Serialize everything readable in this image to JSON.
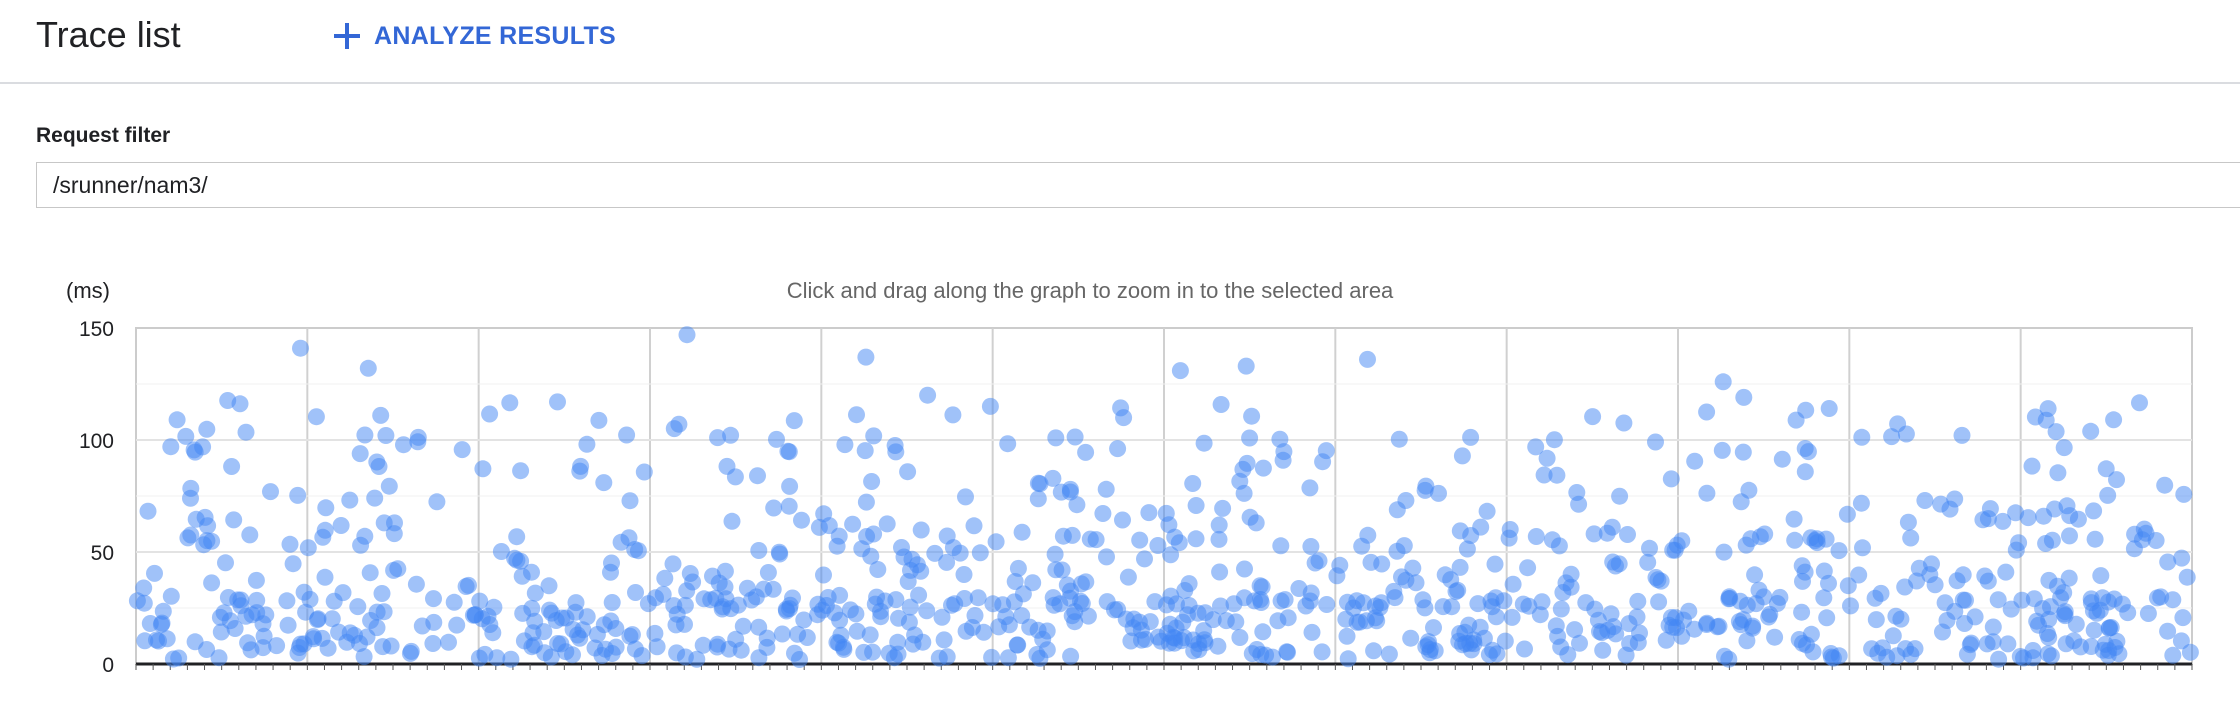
{
  "header": {
    "title": "Trace list",
    "analyze_button_label": "ANALYZE RESULTS",
    "analyze_icon": "plus-icon"
  },
  "filter": {
    "label": "Request filter",
    "value": "/srunner/nam3/"
  },
  "chart": {
    "y_unit_label": "(ms)",
    "hint": "Click and drag along the graph to zoom in to the selected area"
  },
  "colors": {
    "accent": "#3367d6",
    "point": "#4285f4",
    "grid": "#e0e0e0"
  },
  "chart_data": {
    "type": "scatter",
    "title": "",
    "xlabel": "",
    "ylabel": "(ms)",
    "ylim": [
      0,
      150
    ],
    "yticks": [
      0,
      50,
      100,
      150
    ],
    "grid": true,
    "point_count": 960,
    "points_generation": "pseudo-random sample approximating the visible distribution: dense below 40 ms, sparse up to ~150 ms",
    "notable_points": [
      {
        "x": 0.02,
        "y": 109
      },
      {
        "x": 0.08,
        "y": 141
      },
      {
        "x": 0.113,
        "y": 132
      },
      {
        "x": 0.119,
        "y": 111
      },
      {
        "x": 0.205,
        "y": 117
      },
      {
        "x": 0.268,
        "y": 147
      },
      {
        "x": 0.355,
        "y": 137
      },
      {
        "x": 0.385,
        "y": 120
      },
      {
        "x": 0.508,
        "y": 131
      },
      {
        "x": 0.54,
        "y": 133
      },
      {
        "x": 0.599,
        "y": 136
      },
      {
        "x": 0.772,
        "y": 126
      },
      {
        "x": 0.782,
        "y": 119
      },
      {
        "x": 0.93,
        "y": 114
      }
    ]
  }
}
